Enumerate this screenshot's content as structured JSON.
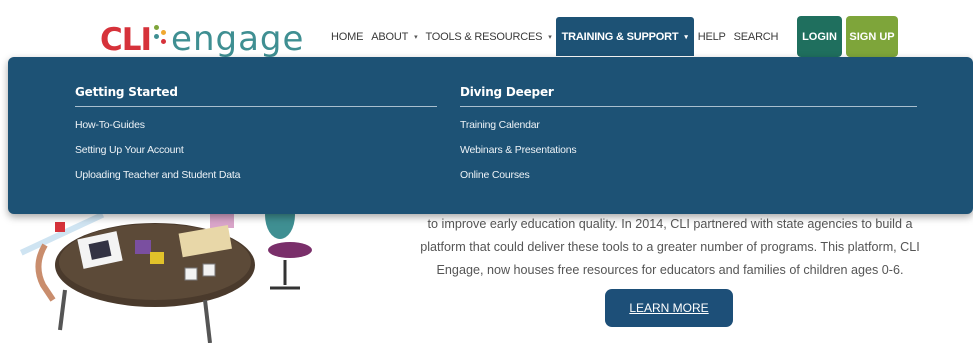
{
  "brand": {
    "logo_left": "CLI",
    "logo_right": "engage",
    "colors": {
      "red": "#d6323a",
      "teal": "#3f8f92",
      "navy": "#1d5275",
      "green": "#1f6f5e",
      "lime": "#7ea53a"
    }
  },
  "nav": {
    "items": [
      {
        "label": "HOME",
        "has_caret": false,
        "active": false
      },
      {
        "label": "ABOUT",
        "has_caret": true,
        "active": false
      },
      {
        "label": "TOOLS & RESOURCES",
        "has_caret": true,
        "active": false
      },
      {
        "label": "TRAINING & SUPPORT",
        "has_caret": true,
        "active": true
      },
      {
        "label": "HELP",
        "has_caret": false,
        "active": false
      },
      {
        "label": "SEARCH",
        "has_caret": false,
        "active": false
      }
    ],
    "caret": "▾",
    "login": "LOGIN",
    "signup": "SIGN UP"
  },
  "dropdown": {
    "columns": [
      {
        "title": "Getting Started",
        "links": [
          "How-To-Guides",
          "Setting Up Your Account",
          "Uploading Teacher and Student Data"
        ]
      },
      {
        "title": "Diving Deeper",
        "links": [
          "Training Calendar",
          "Webinars & Presentations",
          "Online Courses"
        ]
      }
    ]
  },
  "content": {
    "lines": [
      "to improve early education quality. In 2014, CLI partnered with state agencies to build a",
      "platform that could deliver these tools to a greater number of programs. This platform, CLI",
      "Engage, now houses free resources for educators and families of children ages 0-6."
    ],
    "cta": "LEARN MORE"
  }
}
